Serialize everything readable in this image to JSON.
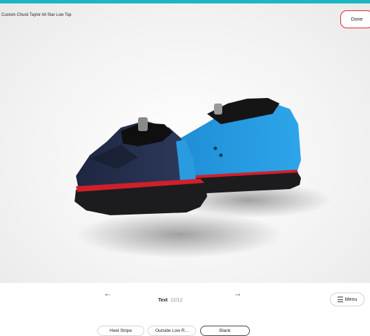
{
  "header": {
    "title": "Custom Chuck Taylor All Star Low Top",
    "done_label": "Done"
  },
  "colors": {
    "accent_bar": "#1ab6c4",
    "done_border": "#d9282f",
    "shoe_left_body": "#2a3450",
    "shoe_right_body": "#2a9be0",
    "sole": "#1c1c1e",
    "stripe": "#d0202a"
  },
  "nav": {
    "prev_icon": "arrow-left-icon",
    "next_icon": "arrow-right-icon",
    "prev_glyph": "←",
    "next_glyph": "→",
    "label": "Text",
    "count": "12/12",
    "menu_label": "Menu"
  },
  "chips": [
    {
      "label": "Heel Stripe"
    },
    {
      "label": "Outside Low R..."
    },
    {
      "label": "Blank",
      "selected": true
    }
  ]
}
